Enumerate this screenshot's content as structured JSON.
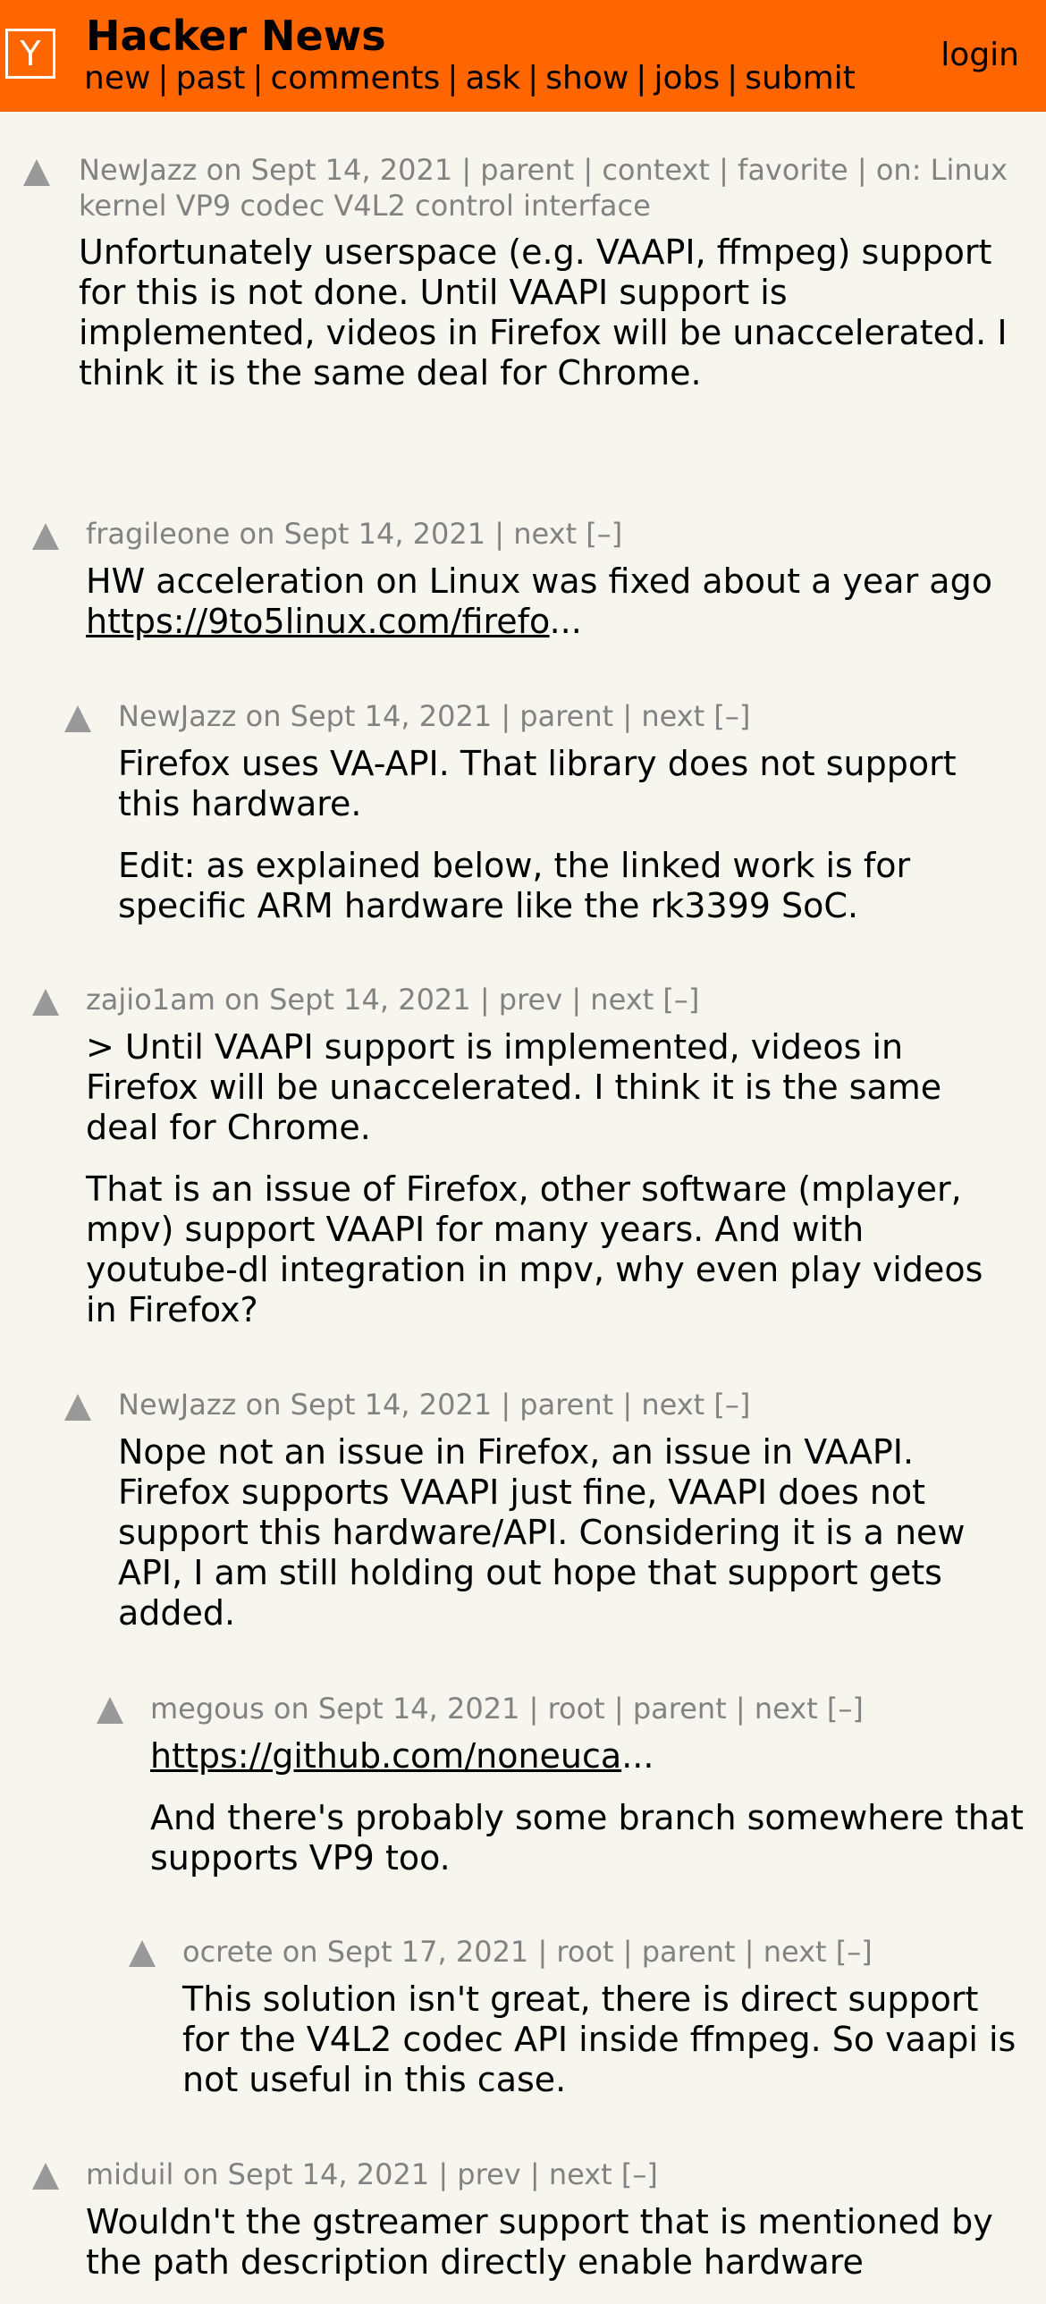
{
  "header": {
    "logo": "Y",
    "title": "Hacker News",
    "nav": [
      "new",
      "past",
      "comments",
      "ask",
      "show",
      "jobs",
      "submit"
    ],
    "separator": "|",
    "login": "login"
  },
  "comments": [
    {
      "user": "NewJazz",
      "date": "on Sept 14, 2021",
      "meta_links": "| parent | context | favorite | on: Linux kernel VP9 codec V4L2 control interface",
      "paragraphs": [
        "Unfortunately userspace (e.g. VAAPI, ffmpeg) support for this is not done. Until VAAPI support is implemented, videos in Firefox will be unaccelerated. I think it is the same deal for Chrome."
      ]
    },
    {
      "user": "fragileone",
      "date": "on Sept 14, 2021",
      "meta_links": "| next [–]",
      "text_prefix": "HW acceleration on Linux was fixed about a year ago ",
      "link": "https://9to5linux.com/firefo",
      "ellipsis": "..."
    },
    {
      "user": "NewJazz",
      "date": "on Sept 14, 2021",
      "meta_links": "| parent | next [–]",
      "paragraphs": [
        "Firefox uses VA-API. That library does not support this hardware.",
        "Edit: as explained below, the linked work is for specific ARM hardware like the rk3399 SoC."
      ]
    },
    {
      "user": "zajio1am",
      "date": "on Sept 14, 2021",
      "meta_links": "| prev | next [–]",
      "paragraphs": [
        "> Until VAAPI support is implemented, videos in Firefox will be unaccelerated. I think it is the same deal for Chrome.",
        "That is an issue of Firefox, other software (mplayer, mpv) support VAAPI for many years. And with youtube-dl integration in mpv, why even play videos in Firefox?"
      ]
    },
    {
      "user": "NewJazz",
      "date": "on Sept 14, 2021",
      "meta_links": "| parent | next [–]",
      "paragraphs": [
        "Nope not an issue in Firefox, an issue in VAAPI. Firefox supports VAAPI just fine, VAAPI does not support this hardware/API. Considering it is a new API, I am still holding out hope that support gets added."
      ]
    },
    {
      "user": "megous",
      "date": "on Sept 14, 2021",
      "meta_links": "| root | parent | next [–]",
      "link": "https://github.com/noneuca",
      "ellipsis": "...",
      "paragraphs": [
        "And there's probably some branch somewhere that supports VP9 too."
      ]
    },
    {
      "user": "ocrete",
      "date": "on Sept 17, 2021",
      "meta_links": "| root | parent | next [–]",
      "paragraphs": [
        "This solution isn't great, there is direct support for the V4L2 codec API inside ffmpeg. So vaapi is not useful in this case."
      ]
    },
    {
      "user": "miduil",
      "date": "on Sept 14, 2021",
      "meta_links": "| prev | next [–]",
      "paragraphs": [
        "Wouldn't the gstreamer support that is mentioned by the path description directly enable hardware"
      ]
    }
  ]
}
